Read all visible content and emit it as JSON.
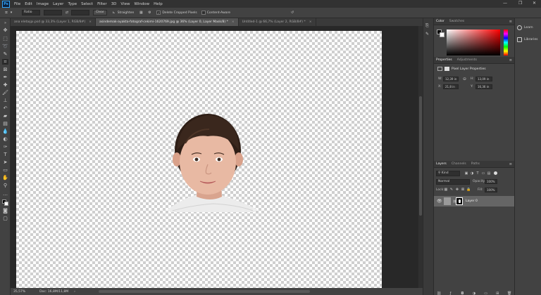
{
  "app": {
    "logo": "Ps"
  },
  "menu": [
    "File",
    "Edit",
    "Image",
    "Layer",
    "Type",
    "Select",
    "Filter",
    "3D",
    "View",
    "Window",
    "Help"
  ],
  "window_controls": {
    "minimize": "—",
    "restore": "❐",
    "close": "✕"
  },
  "options": {
    "ratio": "Ratio",
    "clear": "Clear",
    "straighten": "Straighten",
    "delete_cropped": "Delete Cropped Pixels",
    "content_aware": "Content-Aware",
    "delete_cropped_checked": true
  },
  "tabs": [
    {
      "label": "ana eletaşpı.psd @ 33,3% (Layer 1, RGB/8#)",
      "close": "×",
      "active": false
    },
    {
      "label": "asindemak-ayakta-fotograf-cekimi-1620769.jpg @ 36% (Layer 0, Layer Mask/8) *",
      "close": "×",
      "active": true
    },
    {
      "label": "Untitled-1 @ 66,7% (Layer 2, RGB/8#) *",
      "close": "×",
      "active": false
    }
  ],
  "status": {
    "zoom": "35,57%",
    "doc": "Doc: 16,8M/11,8M",
    "arrow": "›"
  },
  "color_panel": {
    "tabs": [
      "Color",
      "Swatches"
    ],
    "active": "Color"
  },
  "properties_panel": {
    "tabs": [
      "Properties",
      "Adjustments"
    ],
    "title": "Pixel Layer Properties",
    "w_label": "W:",
    "w_value": "12,39 in",
    "h_label": "H:",
    "h_value": "13,09 in",
    "x_label": "X:",
    "x_value": "21,8 in",
    "y_label": "Y:",
    "y_value": "16,36 in"
  },
  "layers_panel": {
    "tabs": [
      "Layers",
      "Channels",
      "Paths"
    ],
    "kind": "Kind",
    "blend": "Normal",
    "opacity_label": "Opacity:",
    "opacity": "100%",
    "lock_label": "Lock:",
    "fill_label": "Fill:",
    "fill": "100%",
    "layer_name": "Layer 0"
  },
  "right_strip": {
    "learn": "Learn",
    "libraries": "Libraries"
  },
  "colors": {
    "accent": "#31a8ff"
  }
}
